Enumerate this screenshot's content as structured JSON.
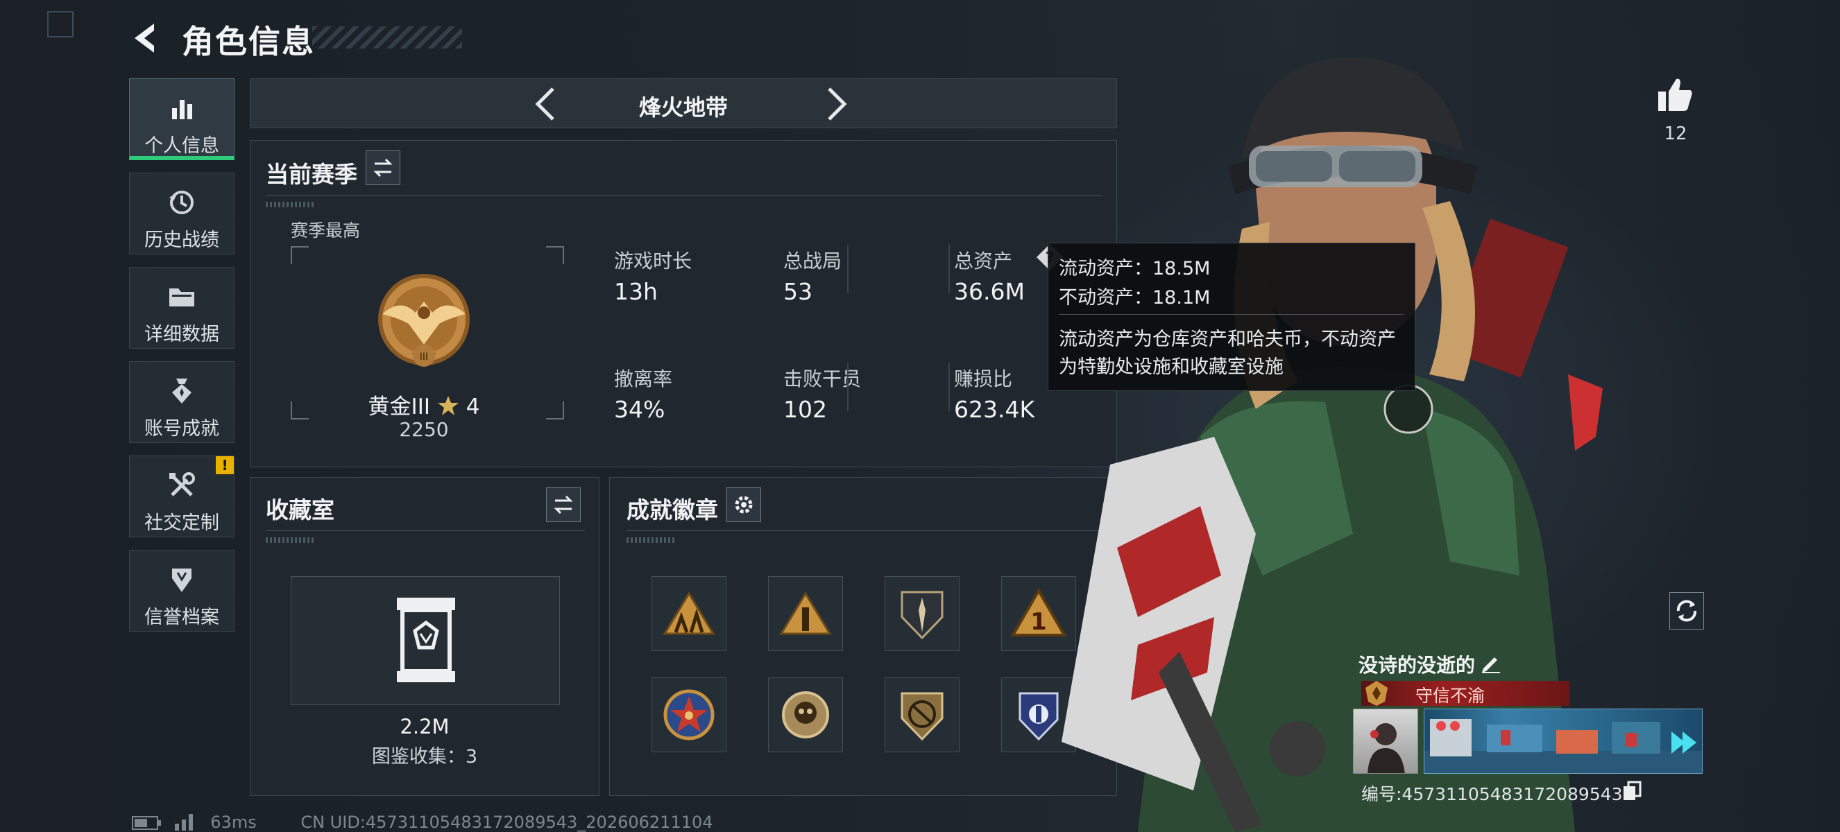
{
  "header": {
    "title": "角色信息"
  },
  "sidebar": {
    "items": [
      {
        "label": "个人信息",
        "icon": "bar-chart-icon",
        "active": true
      },
      {
        "label": "历史战绩",
        "icon": "history-icon"
      },
      {
        "label": "详细数据",
        "icon": "folder-icon"
      },
      {
        "label": "账号成就",
        "icon": "medal-icon"
      },
      {
        "label": "社交定制",
        "icon": "tools-icon",
        "badge": "!"
      },
      {
        "label": "信誉档案",
        "icon": "shield-icon"
      }
    ]
  },
  "mode": {
    "title": "烽火地带"
  },
  "season": {
    "title": "当前赛季",
    "highest_label": "赛季最高",
    "rank_name": "黄金III",
    "rank_stars": "4",
    "rank_score": "2250",
    "rank_emblem_numeral": "III",
    "stats": [
      {
        "label": "游戏时长",
        "value": "13h"
      },
      {
        "label": "总战局",
        "value": "53"
      },
      {
        "label": "总资产",
        "value": "36.6M",
        "help": "?"
      },
      {
        "label": "撤离率",
        "value": "34%"
      },
      {
        "label": "击败干员",
        "value": "102"
      },
      {
        "label": "赚损比",
        "value": "623.4K"
      }
    ]
  },
  "tooltip": {
    "liquid": "流动资产：18.5M",
    "fixed": "不动资产：18.1M",
    "desc_line1": "流动资产为仓库资产和哈夫币，不动资产",
    "desc_line2": "为特勤处设施和收藏室设施"
  },
  "collection": {
    "title": "收藏室",
    "value": "2.2M",
    "catalog": "图鉴收集：3"
  },
  "achievements": {
    "title": "成就徽章",
    "badges": [
      {
        "icon": "soldiers-triangle-icon"
      },
      {
        "icon": "tower-triangle-icon"
      },
      {
        "icon": "dagger-shield-icon"
      },
      {
        "icon": "number-one-triangle-icon",
        "text": "1"
      },
      {
        "icon": "star-roundel-icon"
      },
      {
        "icon": "skull-roundel-icon"
      },
      {
        "icon": "no-gun-shield-icon"
      },
      {
        "icon": "blue-police-badge-icon"
      }
    ]
  },
  "profile": {
    "likes": "12",
    "name": "没诗的没逝的",
    "title_badge": "守信不渝",
    "id_text": "编号:4573110548317208954З",
    "id_value": "编号:45731105483172089543"
  },
  "status": {
    "ping": "63ms",
    "uid": "CN UID:45731105483172089543_202606211104"
  },
  "colors": {
    "accent_green": "#2ecc7a",
    "warning_yellow": "#e8b100",
    "title_red": "#9a1f1f"
  }
}
